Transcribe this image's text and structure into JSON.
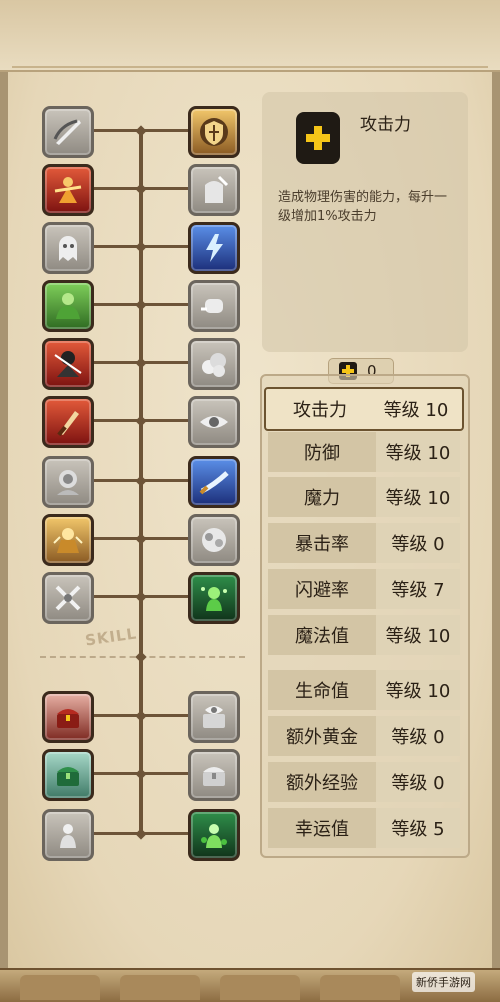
{
  "detail": {
    "title": "攻击力",
    "description": "造成物理伤害的能力，每升一级增加1%攻击力"
  },
  "points": {
    "value": "0"
  },
  "skill_label": "SKILL",
  "stats": [
    {
      "name": "攻击力",
      "level": "等级 10",
      "selected": true
    },
    {
      "name": "防御",
      "level": "等级 10"
    },
    {
      "name": "魔力",
      "level": "等级 10"
    },
    {
      "name": "暴击率",
      "level": "等级 0"
    },
    {
      "name": "闪避率",
      "level": "等级 7"
    },
    {
      "name": "魔法值",
      "level": "等级 10"
    },
    {
      "name": "生命值",
      "level": "等级 10"
    },
    {
      "name": "额外黄金",
      "level": "等级 0"
    },
    {
      "name": "额外经验",
      "level": "等级 0"
    },
    {
      "name": "幸运值",
      "level": "等级 5"
    }
  ],
  "icons": {
    "left": [
      "sword-slash-icon",
      "flame-warrior-icon",
      "ghost-icon",
      "green-brute-icon",
      "dark-assassin-icon",
      "blade-icon",
      "shadow-icon",
      "golden-guardian-icon",
      "crossed-swords-icon",
      "red-chest-icon",
      "green-chest-icon",
      "spirit-icon"
    ],
    "right": [
      "shield-icon",
      "armor-icon",
      "lightning-icon",
      "punch-icon",
      "smoke-icon",
      "eye-icon",
      "blue-sword-icon",
      "cloud-icon",
      "green-magic-icon",
      "eye-chest-icon",
      "gold-chest-icon",
      "clover-spirit-icon"
    ]
  },
  "watermark": "新侨手游网"
}
